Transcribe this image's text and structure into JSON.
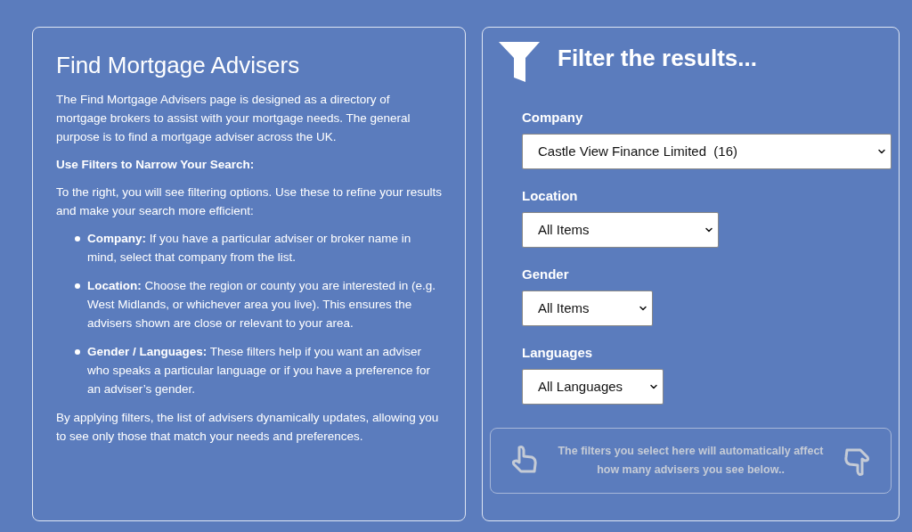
{
  "intro": {
    "title": "Find Mortgage Advisers",
    "paragraph": "The Find Mortgage Advisers page is designed as a directory of mortgage brokers to assist with your mortgage needs.  The general purpose is to find a mortgage adviser across the UK.",
    "subheading": "Use Filters to Narrow Your Search:",
    "lead": "To the right, you will see filtering options. Use these to refine your results and make your search more efficient:",
    "bullets": [
      {
        "term": "Company:",
        "text": "If you have a particular adviser or broker name in mind, select that company from the list."
      },
      {
        "term": "Location:",
        "text": "Choose the region or county you are interested in (e.g. West Midlands, or whichever area you live). This ensures the advisers shown are close or relevant to your area."
      },
      {
        "term": "Gender / Languages:",
        "text": "These filters help if you want an adviser who speaks a particular language or if you have a preference for an adviser’s gender."
      }
    ],
    "closing": "By applying filters, the list of advisers dynamically updates, allowing you to see only those that match your needs and preferences."
  },
  "filters": {
    "title": "Filter the results...",
    "fields": [
      {
        "label": "Company",
        "value": "Castle View Finance Limited  (16)"
      },
      {
        "label": "Location",
        "value": "All Items"
      },
      {
        "label": "Gender",
        "value": "All Items"
      },
      {
        "label": "Languages",
        "value": "All Languages"
      }
    ],
    "note": "The filters you select here will automatically affect how many advisers you see below.."
  }
}
